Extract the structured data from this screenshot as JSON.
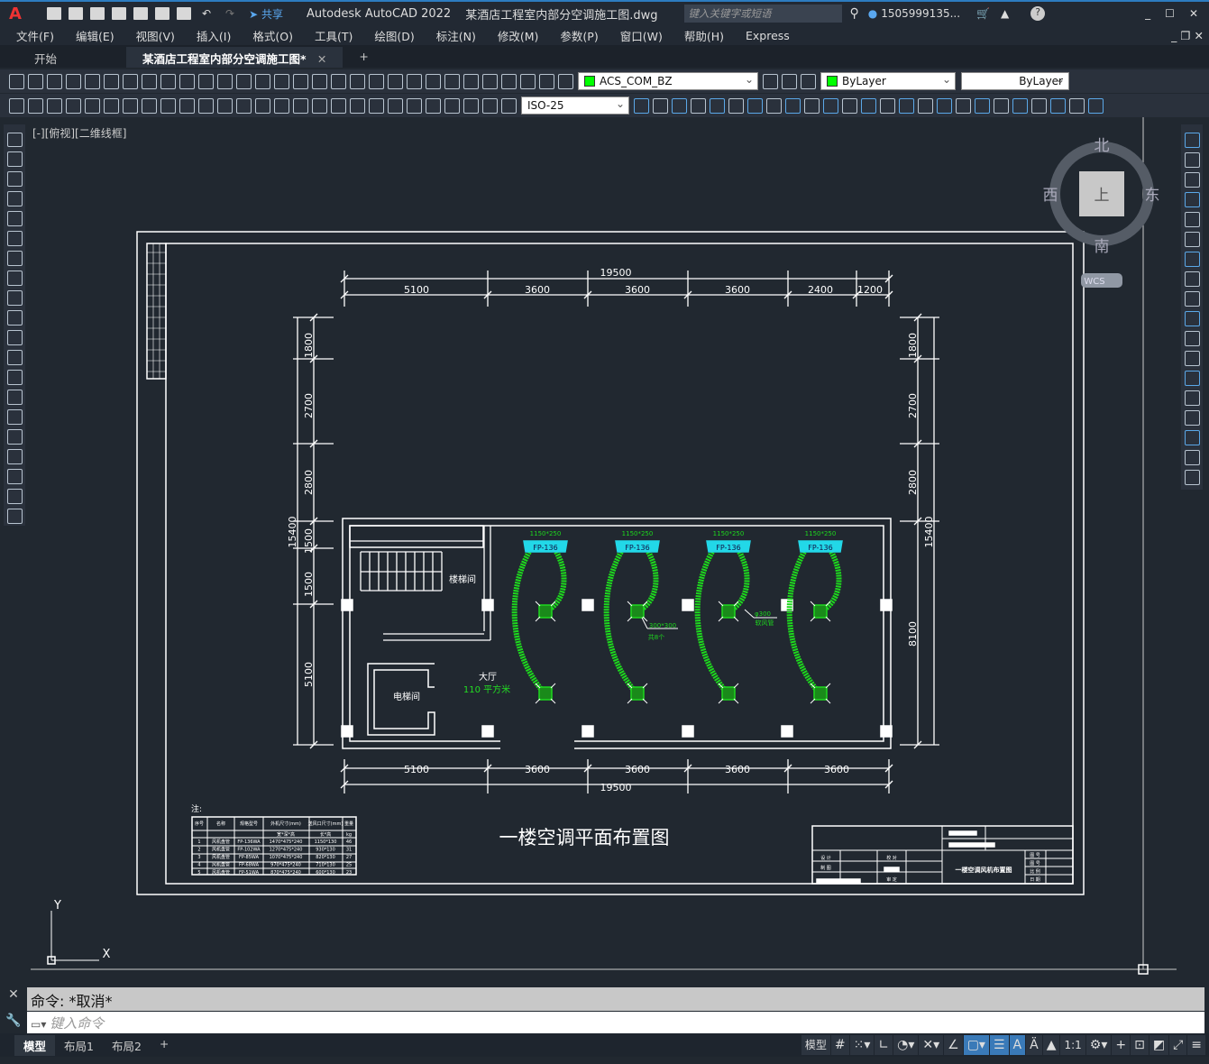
{
  "app": {
    "logo": "A",
    "share": "共享",
    "title": "Autodesk AutoCAD 2022",
    "file": "某酒店工程室内部分空调施工图.dwg",
    "search_placeholder": "键入关键字或短语",
    "user": "1505999135...",
    "window_buttons": [
      "_",
      "☐",
      "✕"
    ]
  },
  "menu": [
    "文件(F)",
    "编辑(E)",
    "视图(V)",
    "插入(I)",
    "格式(O)",
    "工具(T)",
    "绘图(D)",
    "标注(N)",
    "修改(M)",
    "参数(P)",
    "窗口(W)",
    "帮助(H)",
    "Express"
  ],
  "tabs": [
    {
      "label": "开始"
    },
    {
      "label": "某酒店工程室内部分空调施工图*"
    }
  ],
  "toolbar": {
    "layer": "ACS_COM_BZ",
    "color": "ByLayer",
    "linetype": "ByLayer",
    "dimstyle": "ISO-25",
    "layer_color": "#00ff00"
  },
  "viewport": {
    "label": "[-][俯视][二维线框]"
  },
  "viewcube": {
    "north": "北",
    "south": "南",
    "east": "东",
    "west": "西",
    "top": "上",
    "wcs": "WCS"
  },
  "drawing": {
    "top_total": "19500",
    "top_dims": [
      "5100",
      "3600",
      "3600",
      "3600",
      "2400",
      "1200"
    ],
    "bottom_total": "19500",
    "bottom_dims": [
      "5100",
      "3600",
      "3600",
      "3600",
      "3600"
    ],
    "left_total": "15400",
    "left_dims": [
      "1800",
      "2700",
      "2800",
      "1500",
      "1500",
      "5100"
    ],
    "right_total": "15400",
    "right_dims": [
      "1800",
      "2700",
      "2800",
      "8100"
    ],
    "stair": "楼梯间",
    "elevator": "电梯间",
    "hall": "大厅",
    "hall_area": "110  平方米",
    "unit_size": "1150*250",
    "unit_label": "FP-136",
    "diffuser_size": "300*300",
    "diffuser_count": "共8个",
    "duct_size": "φ300",
    "duct_label": "软风管",
    "title": "一楼空调平面布置图",
    "note": "注:",
    "table": {
      "headers": [
        "序号",
        "名称",
        "规格型号",
        "外机尺寸(mm)",
        "送风口尺寸(mm)",
        "重量"
      ],
      "subheaders": [
        "宽*深*高",
        "长*高",
        "kg"
      ],
      "rows": [
        [
          "1",
          "风机盘管",
          "FP-136WA",
          "1470*475*240",
          "1150*130",
          "46"
        ],
        [
          "2",
          "风机盘管",
          "FP-102WA",
          "1270*475*240",
          "930*130",
          "31"
        ],
        [
          "3",
          "风机盘管",
          "FP-85WA",
          "1070*475*240",
          "820*130",
          "27"
        ],
        [
          "4",
          "风机盘管",
          "FP-68WA",
          "970*475*240",
          "710*130",
          "25"
        ],
        [
          "5",
          "风机盘管",
          "FP-51WA",
          "870*475*240",
          "600*130",
          "23"
        ]
      ]
    },
    "titleblock": {
      "design": "设 计",
      "draw": "制 图",
      "check": "校 对",
      "review": "审 定",
      "sheet_title": "一楼空调风机布置图",
      "no": "图 号",
      "code": "图 号",
      "scale": "比 例",
      "date": "日 期"
    },
    "ucs": {
      "x": "X",
      "y": "Y"
    }
  },
  "command": {
    "history": "命令: *取消*",
    "placeholder": "键入命令"
  },
  "layouts": [
    "模型",
    "布局1",
    "布局2",
    "+"
  ],
  "status": {
    "model": "模型",
    "scale": "1:1"
  }
}
